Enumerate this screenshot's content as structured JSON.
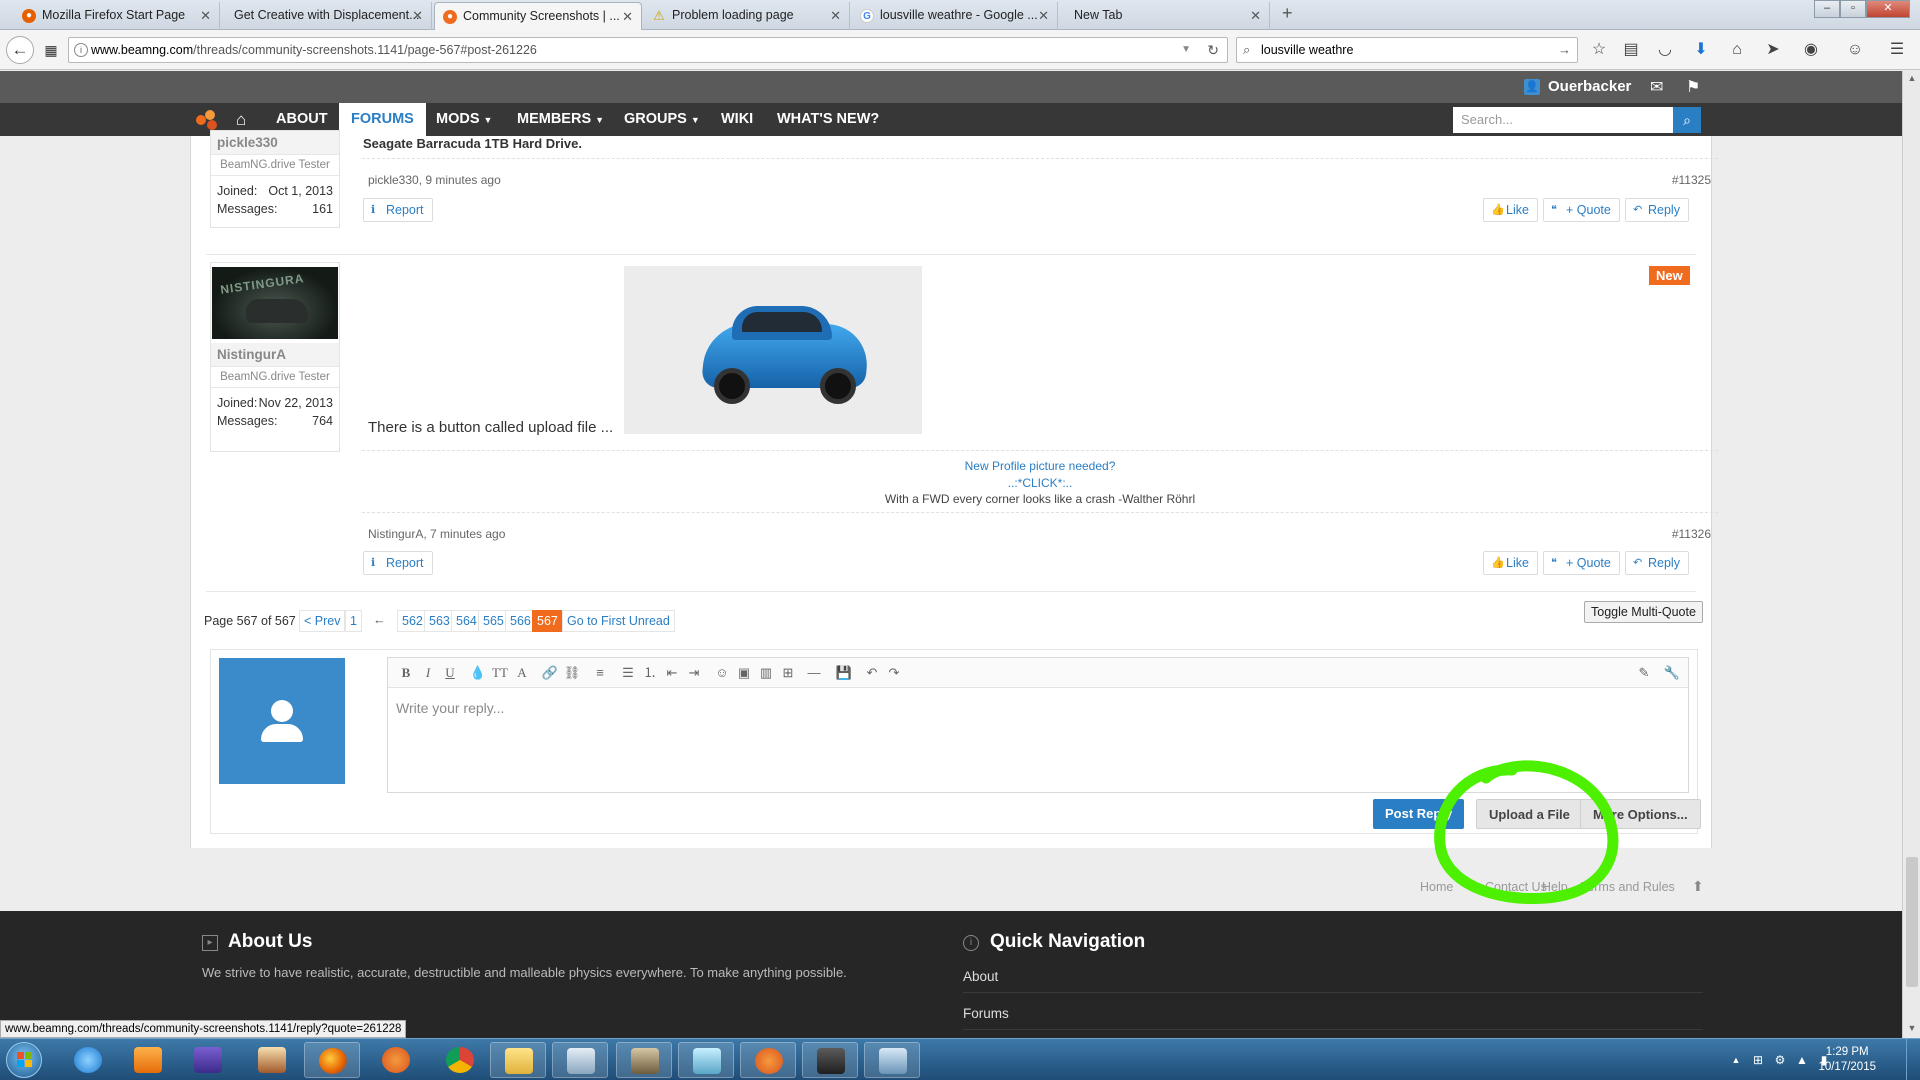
{
  "browser": {
    "tabs": [
      {
        "label": "Mozilla Firefox Start Page",
        "icon": "firefox-icon",
        "active": false
      },
      {
        "label": "Get Creative with Displacement...",
        "icon": "none",
        "active": false
      },
      {
        "label": "Community Screenshots | ...",
        "icon": "beamng-icon",
        "active": true
      },
      {
        "label": "Problem loading page",
        "icon": "warning-icon",
        "active": false
      },
      {
        "label": "lousville weathre - Google ...",
        "icon": "google-icon",
        "active": false
      },
      {
        "label": "New Tab",
        "icon": "none",
        "active": false
      }
    ],
    "url_domain": "www.beamng.com",
    "url_path": "/threads/community-screenshots.1141/page-567#post-261226",
    "search_value": "lousville weathre",
    "status_url": "www.beamng.com/threads/community-screenshots.1141/reply?quote=261228"
  },
  "site": {
    "username": "Ouerbacker",
    "nav": [
      "ABOUT",
      "FORUMS",
      "MODS",
      "MEMBERS",
      "GROUPS",
      "WIKI",
      "WHAT'S NEW?"
    ],
    "active_nav": "FORUMS",
    "search_placeholder": "Search...",
    "accent": "#2a7ec4",
    "brand": "#f16b1f"
  },
  "posts": [
    {
      "username": "pickle330",
      "role": "BeamNG.drive Tester",
      "joined_label": "Joined:",
      "joined": "Oct 1, 2013",
      "messages_label": "Messages:",
      "messages": "161",
      "text": "Seagate Barracuda 1TB Hard Drive.",
      "meta": "pickle330, 9 minutes ago",
      "number": "#11325"
    },
    {
      "username": "NistingurA",
      "avatar_text": "NISTINGURA",
      "role": "BeamNG.drive Tester",
      "joined_label": "Joined:",
      "joined": "Nov 22, 2013",
      "messages_label": "Messages:",
      "messages": "764",
      "text": "There is a button called upload file ...",
      "badge": "New",
      "sig_link1": "New Profile picture needed?",
      "sig_link2": "..:*CLICK*:..",
      "sig_text": "With a FWD every corner looks like a crash -Walther Röhrl",
      "meta": "NistingurA, 7 minutes ago",
      "number": "#11326"
    }
  ],
  "actions": {
    "report": "Report",
    "like": "Like",
    "quote": "+ Quote",
    "reply": "Reply"
  },
  "pagination": {
    "label": "Page 567 of 567",
    "prev": "< Prev",
    "first": "1",
    "ellipsis": "←",
    "pages": [
      "562",
      "563",
      "564",
      "565",
      "566",
      "567"
    ],
    "current": "567",
    "first_unread": "Go to First Unread",
    "toggle": "Toggle Multi-Quote"
  },
  "editor": {
    "placeholder": "Write your reply...",
    "post_reply": "Post Reply",
    "upload": "Upload a File",
    "more": "More Options..."
  },
  "footer": {
    "links": [
      "Home",
      "Contact Us",
      "Help",
      "Terms and Rules"
    ],
    "about_title": "About Us",
    "about_text": "We strive to have realistic, accurate, destructible and malleable physics everywhere. To make anything possible.",
    "qn_title": "Quick Navigation",
    "qn_items": [
      "About",
      "Forums"
    ]
  },
  "taskbar": {
    "time": "1:29 PM",
    "date": "10/17/2015"
  },
  "annotation": {
    "color": "#4cf000"
  }
}
